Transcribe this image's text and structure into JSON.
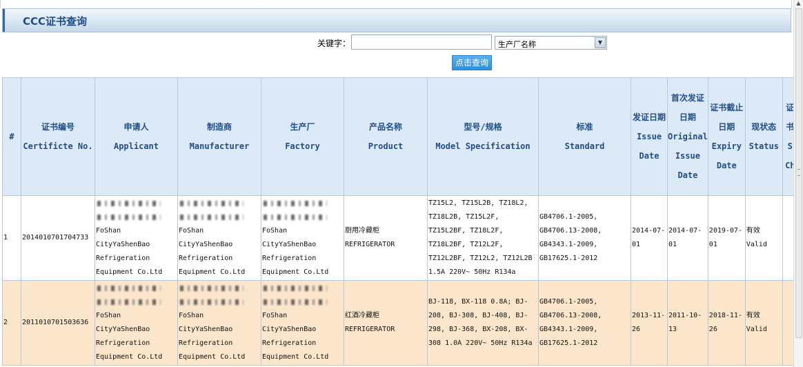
{
  "header": {
    "title": "CCC证书查询"
  },
  "search": {
    "label": "关键字：",
    "value": "",
    "select_value": "生产厂名称",
    "button_label": "点击查询"
  },
  "table": {
    "headers": [
      {
        "cn": "#",
        "en": ""
      },
      {
        "cn": "证书编号",
        "en": "Certificte No."
      },
      {
        "cn": "申请人",
        "en": "Applicant"
      },
      {
        "cn": "制造商",
        "en": "Manufacturer"
      },
      {
        "cn": "生产厂",
        "en": "Factory"
      },
      {
        "cn": "产品名称",
        "en": "Product"
      },
      {
        "cn": "型号/规格",
        "en": "Model Specification"
      },
      {
        "cn": "标准",
        "en": "Standard"
      },
      {
        "cn": "发证日期",
        "en": "Issue Date"
      },
      {
        "cn": "首次发证日期",
        "en": "Original Issue Date"
      },
      {
        "cn": "证书截止日期",
        "en": "Expiry Date"
      },
      {
        "cn": "现状态",
        "en": "Status"
      },
      {
        "cn": "证书",
        "en": "S Ch"
      }
    ],
    "rows": [
      {
        "num": "1",
        "cert_no": "2014010701704733",
        "applicant": [
          "FoShan",
          "CityYaShenBao",
          "Refrigeration",
          "Equipment Co.Ltd"
        ],
        "manufacturer": [
          "FoShan",
          "CityYaShenBao",
          "Refrigeration",
          "Equipment Co.Ltd"
        ],
        "factory": [
          "FoShan",
          "CityYaShenBao",
          "Refrigeration",
          "Equipment Co.Ltd"
        ],
        "product": [
          "厨用冷藏柜",
          "REFRIGERATOR"
        ],
        "model": [
          "TZ15L2, TZ15L2B, TZ18L2,",
          "TZ18L2B, TZ15L2F,",
          "TZ15L2BF, TZ18L2F,",
          "TZ18L2BF, TZ12L2F,",
          "TZ12L2BF, TZ12L2, TZ12L2B",
          "1.5A 220V~ 50Hz R134a"
        ],
        "standard": [
          "GB4706.1-2005,",
          "GB4706.13-2008,",
          "GB4343.1-2009,",
          "GB17625.1-2012"
        ],
        "issue_date": [
          "2014-07-",
          "01"
        ],
        "original_date": [
          "2014-07-",
          "01"
        ],
        "expiry_date": [
          "2019-07-",
          "01"
        ],
        "status": [
          "有效",
          "Valid"
        ]
      },
      {
        "num": "2",
        "cert_no": "2011010701503636",
        "applicant": [
          "FoShan",
          "CityYaShenBao",
          "Refrigeration",
          "Equipment Co.Ltd"
        ],
        "manufacturer": [
          "FoShan",
          "CityYaShenBao",
          "Refrigeration",
          "Equipment Co.Ltd"
        ],
        "factory": [
          "FoShan",
          "CityYaShenBao",
          "Refrigeration",
          "Equipment Co.Ltd"
        ],
        "product": [
          "红酒冷藏柜",
          "REFRIGERATOR"
        ],
        "model": [
          "BJ-118, BX-118 0.8A; BJ-",
          "208, BJ-308, BJ-408, BJ-",
          "298, BJ-368, BX-208, BX-",
          "308 1.0A 220V~ 50Hz R134a"
        ],
        "standard": [
          "GB4706.1-2005,",
          "GB4706.13-2008,",
          "GB4343.1-2009,",
          "GB17625.1-2012"
        ],
        "issue_date": [
          "2013-11-",
          "26"
        ],
        "original_date": [
          "2011-10-",
          "13"
        ],
        "expiry_date": [
          "2018-11-",
          "26"
        ],
        "status": [
          "有效",
          "Valid"
        ]
      }
    ]
  }
}
